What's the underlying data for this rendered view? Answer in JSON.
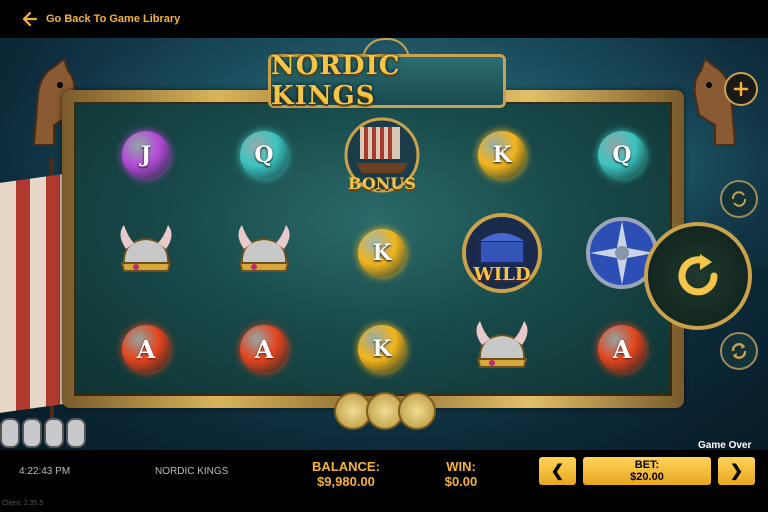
{
  "topbar": {
    "back_label": "Go Back To Game Library"
  },
  "game": {
    "title": "NORDIC KINGS"
  },
  "reels": {
    "rows": [
      [
        {
          "symbol": "J",
          "type": "gem",
          "color": "#b449d8"
        },
        {
          "symbol": "Q",
          "type": "gem",
          "color": "#3cc4c0"
        },
        {
          "symbol": "BONUS",
          "type": "bonus",
          "color": "#c9a24b"
        },
        {
          "symbol": "K",
          "type": "gem",
          "color": "#f3b41b"
        },
        {
          "symbol": "Q",
          "type": "gem",
          "color": "#3cc4c0"
        }
      ],
      [
        {
          "symbol": "helmet",
          "type": "helmet",
          "color": "#c0c0c0"
        },
        {
          "symbol": "helmet",
          "type": "helmet",
          "color": "#c0c0c0"
        },
        {
          "symbol": "K",
          "type": "gem",
          "color": "#f3b41b"
        },
        {
          "symbol": "WILD",
          "type": "wild",
          "color": "#3454b8"
        },
        {
          "symbol": "shield",
          "type": "shield",
          "color": "#2d4fb5"
        }
      ],
      [
        {
          "symbol": "A",
          "type": "gem",
          "color": "#e4441d"
        },
        {
          "symbol": "A",
          "type": "gem",
          "color": "#e4441d"
        },
        {
          "symbol": "K",
          "type": "gem",
          "color": "#f3b41b"
        },
        {
          "symbol": "helmet",
          "type": "helmet",
          "color": "#c0c0c0"
        },
        {
          "symbol": "A",
          "type": "gem",
          "color": "#e4441d"
        }
      ]
    ]
  },
  "status": {
    "game_over": "Game Over"
  },
  "bottombar": {
    "time": "4:22:43 PM",
    "game_name": "NORDIC KINGS",
    "balance_label": "BALANCE:",
    "balance_value": "$9,980.00",
    "win_label": "WIN:",
    "win_value": "$0.00",
    "bet_label": "BET:",
    "bet_value": "$20.00",
    "bet_decrease": "❮",
    "bet_increase": "❯"
  },
  "client_version": "Client: 2.35.5",
  "colors": {
    "accent": "#f5b335",
    "frame_gold": "#c9a24b"
  }
}
